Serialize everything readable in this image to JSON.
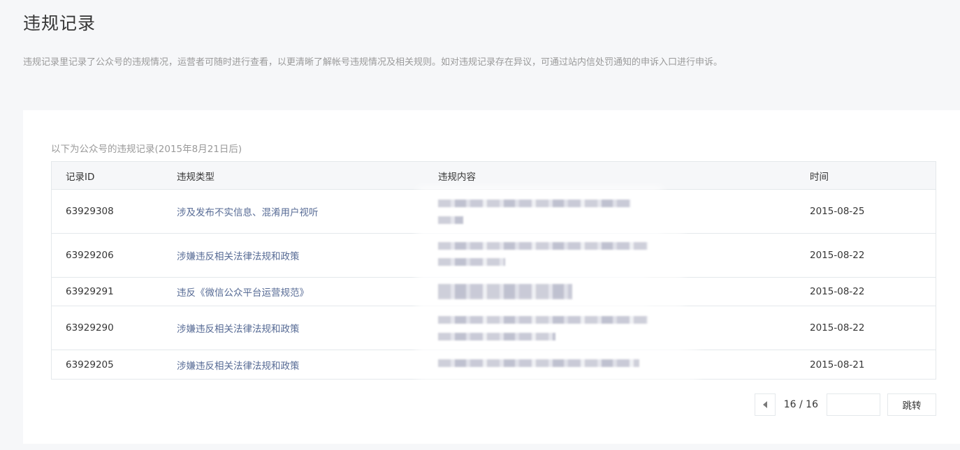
{
  "header": {
    "title": "违规记录",
    "description": "违规记录里记录了公众号的违规情况，运营者可随时进行查看，以更清晰了解帐号违规情况及相关规则。如对违规记录存在异议，可通过站内信处罚通知的申诉入口进行申诉。"
  },
  "table": {
    "caption": "以下为公众号的违规记录(2015年8月21日后)",
    "columns": [
      "记录ID",
      "违规类型",
      "违规内容",
      "时间"
    ],
    "rows": [
      {
        "id": "63929308",
        "type": "涉及发布不实信息、混淆用户视听",
        "content": "[blurred]",
        "time": "2015-08-25"
      },
      {
        "id": "63929206",
        "type": "涉嫌违反相关法律法规和政策",
        "content": "[blurred]",
        "time": "2015-08-22"
      },
      {
        "id": "63929291",
        "type": "违反《微信公众平台运营规范》",
        "content": "[blurred]",
        "time": "2015-08-22"
      },
      {
        "id": "63929290",
        "type": "涉嫌违反相关法律法规和政策",
        "content": "[blurred]",
        "time": "2015-08-22"
      },
      {
        "id": "63929205",
        "type": "涉嫌违反相关法律法规和政策",
        "content": "[blurred]",
        "time": "2015-08-21"
      }
    ]
  },
  "pagination": {
    "page_text": "16 / 16",
    "input_value": "",
    "input_placeholder": "",
    "jump_label": "跳转",
    "prev_icon": "caret-left-icon"
  }
}
